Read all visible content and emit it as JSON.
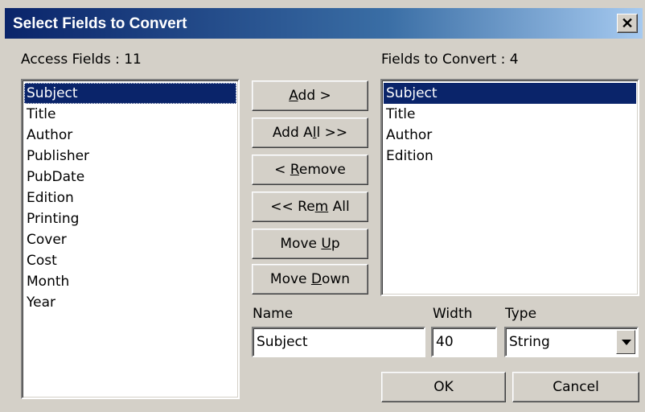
{
  "window": {
    "title": "Select Fields to Convert",
    "close_label": "✕"
  },
  "left_panel": {
    "heading": "Access Fields : 11",
    "items": [
      "Subject",
      "Title",
      "Author",
      "Publisher",
      "PubDate",
      "Edition",
      "Printing",
      "Cover",
      "Cost",
      "Month",
      "Year"
    ],
    "selected_index": 0
  },
  "right_panel": {
    "heading": "Fields to Convert : 4",
    "items": [
      "Subject",
      "Title",
      "Author",
      "Edition"
    ],
    "selected_index": 0
  },
  "buttons": {
    "add": {
      "pre": "",
      "key": "A",
      "post": "dd >"
    },
    "add_all": {
      "pre": "Add A",
      "key": "l",
      "post": "l >>"
    },
    "remove": {
      "pre": "< ",
      "key": "R",
      "post": "emove"
    },
    "rem_all": {
      "pre": "<< Re",
      "key": "m",
      "post": " All"
    },
    "move_up": {
      "pre": "Move ",
      "key": "U",
      "post": "p"
    },
    "move_down": {
      "pre": "Move ",
      "key": "D",
      "post": "own"
    },
    "ok": "OK",
    "cancel": "Cancel"
  },
  "form": {
    "name_label": "Name",
    "name_value": "Subject",
    "width_label": "Width",
    "width_value": "40",
    "type_label": "Type",
    "type_value": "String"
  },
  "icons": {
    "close": "close-icon",
    "dropdown": "chevron-down-icon"
  },
  "colors": {
    "selection": "#0a246a",
    "titlebar_start": "#0a246a",
    "titlebar_end": "#a6caf0",
    "face": "#d4d0c8"
  }
}
